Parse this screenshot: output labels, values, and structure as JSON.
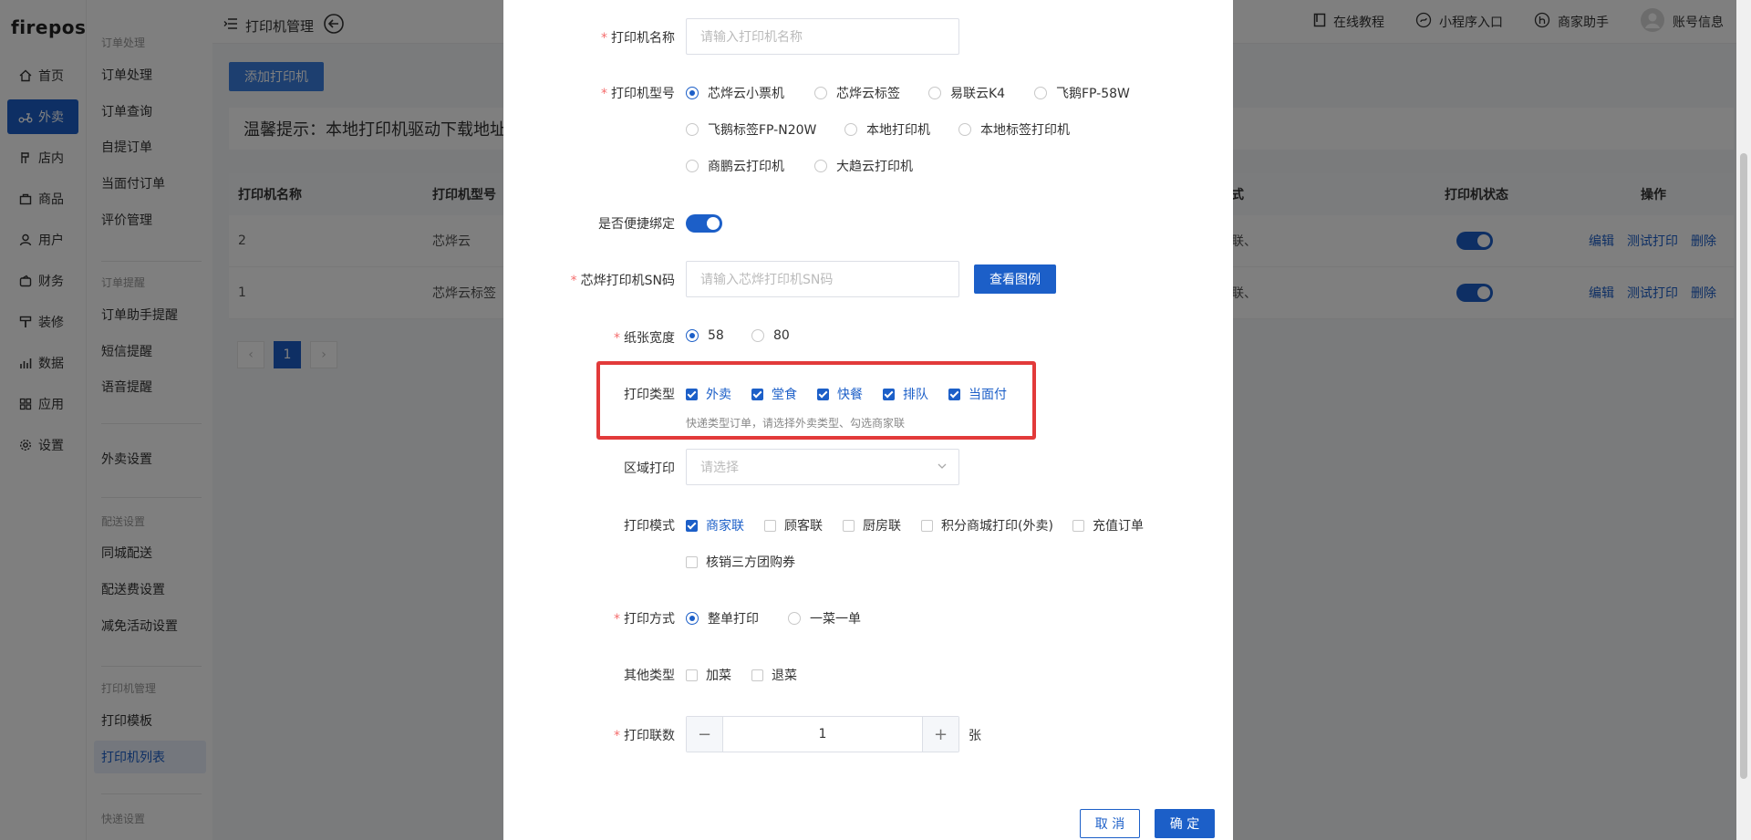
{
  "app": {
    "logo": "firepos"
  },
  "nav1": [
    {
      "label": "首页",
      "icon": "home-icon"
    },
    {
      "label": "外卖",
      "icon": "scooter-icon",
      "active": true
    },
    {
      "label": "店内",
      "icon": "store-icon"
    },
    {
      "label": "商品",
      "icon": "bag-icon"
    },
    {
      "label": "用户",
      "icon": "user-icon"
    },
    {
      "label": "财务",
      "icon": "wallet-icon"
    },
    {
      "label": "装修",
      "icon": "brush-icon"
    },
    {
      "label": "数据",
      "icon": "chart-icon"
    },
    {
      "label": "应用",
      "icon": "grid-icon"
    },
    {
      "label": "设置",
      "icon": "gear-icon"
    }
  ],
  "nav2": {
    "group_order": "订单处理",
    "order_items": [
      "订单处理",
      "订单查询",
      "自提订单",
      "当面付订单",
      "评价管理"
    ],
    "group_remind": "订单提醒",
    "remind_items": [
      "订单助手提醒",
      "短信提醒",
      "语音提醒"
    ],
    "takeout_setting": "外卖设置",
    "group_delivery": "配送设置",
    "delivery_items": [
      "同城配送",
      "配送费设置",
      "减免活动设置"
    ],
    "group_printer": "打印机管理",
    "printer_items": [
      "打印模板",
      "打印机列表"
    ],
    "group_express": "快递设置"
  },
  "topbar": {
    "title": "打印机管理",
    "links": [
      "在线教程",
      "小程序入口",
      "商家助手",
      "账号信息"
    ]
  },
  "page": {
    "add_button": "添加打印机",
    "tip": "温馨提示：本地打印机驱动下载地址",
    "columns": [
      "打印机名称",
      "打印机型号",
      "式",
      "打印机状态",
      "操作"
    ],
    "rows": [
      {
        "name": "2",
        "model": "芯烨云",
        "mode": "联、"
      },
      {
        "name": "1",
        "model": "芯烨云标签",
        "mode": "联、"
      }
    ],
    "ops": [
      "编辑",
      "测试打印",
      "删除"
    ],
    "page_num": "1"
  },
  "modal": {
    "name_label": "打印机名称",
    "name_placeholder": "请输入打印机名称",
    "model_label": "打印机型号",
    "models": [
      "芯烨云小票机",
      "芯烨云标签",
      "易联云K4",
      "飞鹅FP-58W",
      "飞鹅标签FP-N20W",
      "本地打印机",
      "本地标签打印机",
      "商鹏云打印机",
      "大趋云打印机"
    ],
    "quick_bind_label": "是否便捷绑定",
    "sn_label": "芯烨打印机SN码",
    "sn_placeholder": "请输入芯烨打印机SN码",
    "view_example": "查看图例",
    "paper_label": "纸张宽度",
    "paper_options": [
      "58",
      "80"
    ],
    "print_type_label": "打印类型",
    "print_types": [
      "外卖",
      "堂食",
      "快餐",
      "排队",
      "当面付"
    ],
    "print_type_hint": "快递类型订单，请选择外卖类型、勾选商家联",
    "area_label": "区域打印",
    "area_placeholder": "请选择",
    "mode_label": "打印模式",
    "modes": [
      "商家联",
      "顾客联",
      "厨房联",
      "积分商城打印(外卖)",
      "充值订单",
      "核销三方团购券"
    ],
    "method_label": "打印方式",
    "methods": [
      "整单打印",
      "一菜一单"
    ],
    "other_label": "其他类型",
    "others": [
      "加菜",
      "退菜"
    ],
    "copies_label": "打印联数",
    "copies_value": "1",
    "copies_unit": "张",
    "cancel": "取 消",
    "confirm": "确 定"
  }
}
